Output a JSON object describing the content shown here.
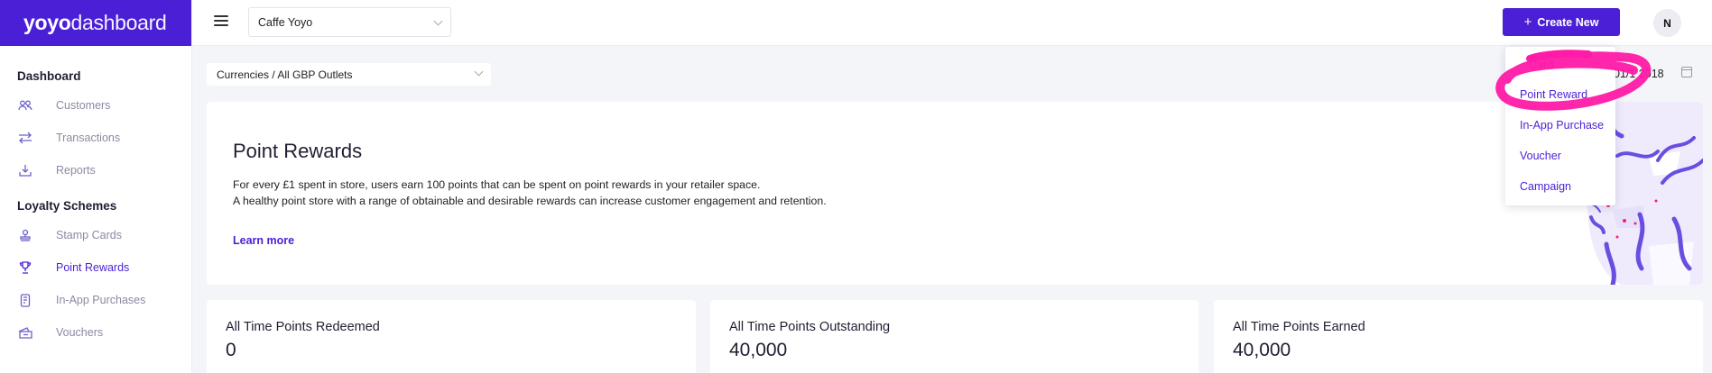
{
  "brand": {
    "part1": "yoyo",
    "part2": "dashboard"
  },
  "sidebar": {
    "section1": "Dashboard",
    "items1": [
      {
        "label": "Customers",
        "icon": "users-icon"
      },
      {
        "label": "Transactions",
        "icon": "arrows-icon"
      },
      {
        "label": "Reports",
        "icon": "download-icon"
      }
    ],
    "section2": "Loyalty Schemes",
    "items2": [
      {
        "label": "Stamp Cards",
        "icon": "stamp-icon"
      },
      {
        "label": "Point Rewards",
        "icon": "trophy-icon",
        "active": true
      },
      {
        "label": "In-App Purchases",
        "icon": "phone-icon"
      },
      {
        "label": "Vouchers",
        "icon": "ticket-icon"
      }
    ]
  },
  "topbar": {
    "store": "Caffe Yoyo",
    "create_label": "Create New",
    "avatar": "N"
  },
  "filters": {
    "currency": "Currencies / All GBP Outlets",
    "date": "01/1   2018"
  },
  "hero": {
    "title": "Point Rewards",
    "line1": "For every £1 spent in store, users earn 100 points that can be spent on point rewards in your retailer space.",
    "line2": "A healthy point store with a range of obtainable and desirable rewards can increase customer engagement and retention.",
    "learn_more": "Learn more"
  },
  "stats": [
    {
      "label": "All Time Points Redeemed",
      "value": "0"
    },
    {
      "label": "All Time Points Outstanding",
      "value": "40,000"
    },
    {
      "label": "All Time Points Earned",
      "value": "40,000"
    }
  ],
  "dropdown": {
    "partial": "   Card",
    "items": [
      "Point Reward",
      "In-App Purchase",
      "Voucher",
      "Campaign"
    ]
  },
  "colors": {
    "accent": "#4b1fd6",
    "annotation": "#ff1aa8"
  }
}
